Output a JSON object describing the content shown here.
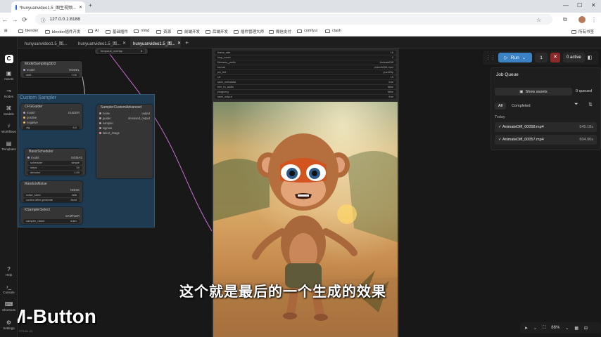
{
  "browser": {
    "tabs": [
      {
        "label": "*hunyuanvideo1.5_图生视频..."
      },
      {
        "label": "ComfyUI"
      }
    ],
    "url": "127.0.0.1:8188",
    "bookmarks": [
      "blender",
      "blender插件开发",
      "AI",
      "基础插件",
      "mmd",
      "资源",
      "前端开发",
      "后端开发",
      "插件管理大师",
      "微信支付",
      "comfyui",
      "clash"
    ],
    "all_bookmarks": "所有书签"
  },
  "sidebar": {
    "items": [
      {
        "label": "Assets",
        "icon": "assets-icon"
      },
      {
        "label": "Nodes",
        "icon": "nodes-icon"
      },
      {
        "label": "Models",
        "icon": "models-icon"
      },
      {
        "label": "Workflows",
        "icon": "workflows-icon"
      },
      {
        "label": "Templates",
        "icon": "templates-icon"
      }
    ],
    "bottom": [
      {
        "label": "Help"
      },
      {
        "label": "Console"
      },
      {
        "label": "Shortcuts"
      },
      {
        "label": "Settings"
      }
    ]
  },
  "workflow_tabs": [
    {
      "label": "hunyuanvideo1.5_图..."
    },
    {
      "label": "hunyuanvideo1.5_图..."
    },
    {
      "label": "hunyuanvideo1.5_图..."
    }
  ],
  "group_title": "Custom Sampler",
  "nodes": {
    "model_sampling": {
      "title": "ModelSamplingSD3",
      "out": "MODEL",
      "in": "model",
      "shift_label": "shift",
      "shift_value": "7.00"
    },
    "cfg_guider": {
      "title": "CFGGuider",
      "out": "GUIDER",
      "inputs": [
        "model",
        "positive",
        "negative"
      ],
      "cfg_label": "cfg",
      "cfg_value": "6.0"
    },
    "sampler_custom": {
      "title": "SamplerCustomAdvanced",
      "inputs": [
        "noise",
        "guider",
        "sampler",
        "sigmas",
        "latent_image"
      ],
      "outputs": [
        "output",
        "denoised_output"
      ]
    },
    "basic_scheduler": {
      "title": "BasicScheduler",
      "out": "SIGMAS",
      "in": "model",
      "widgets": [
        {
          "label": "scheduler",
          "value": "simple"
        },
        {
          "label": "steps",
          "value": "50"
        },
        {
          "label": "denoise",
          "value": "1.00"
        }
      ]
    },
    "random_noise": {
      "title": "RandomNoise",
      "out": "NOISE",
      "widgets": [
        {
          "label": "noise_seed",
          "value": "666"
        },
        {
          "label": "control after generate",
          "value": "fixed"
        }
      ]
    },
    "ksampler_select": {
      "title": "KSamplerSelect",
      "out": "SAMPLER",
      "widgets": [
        {
          "label": "sampler_name",
          "value": "euler"
        }
      ]
    },
    "top_widget": {
      "label": "temporal_overlap",
      "value": "8"
    }
  },
  "video_combine": {
    "widgets": [
      {
        "label": "frame_rate",
        "value": "16"
      },
      {
        "label": "loop_count",
        "value": "0"
      },
      {
        "label": "filename_prefix",
        "value": "AnimateDiff"
      },
      {
        "label": "format",
        "value": "video/h264-mp4"
      },
      {
        "label": "pix_fmt",
        "value": "yuv420p"
      },
      {
        "label": "crf",
        "value": "19"
      },
      {
        "label": "save_metadata",
        "value": "true"
      },
      {
        "label": "trim_to_audio",
        "value": "false"
      },
      {
        "label": "pingpong",
        "value": "false"
      },
      {
        "label": "save_output",
        "value": "true"
      }
    ]
  },
  "subtitle": "这个就是最后的一个生成的效果",
  "overlay_label": "M-Button",
  "fps": "FPS:61.24",
  "run": {
    "label": "Run",
    "count": "1",
    "active": "0 active"
  },
  "job_queue": {
    "title": "Job Queue",
    "show_assets": "Show assets",
    "queued": "0 queued",
    "filter_all": "All",
    "filter_completed": "Completed",
    "section": "Today",
    "jobs": [
      {
        "name": "AnimateDiff_00058.mp4",
        "time": "545.18s"
      },
      {
        "name": "AnimateDiff_00057.mp4",
        "time": "604.90s"
      }
    ]
  },
  "zoom": "86%"
}
